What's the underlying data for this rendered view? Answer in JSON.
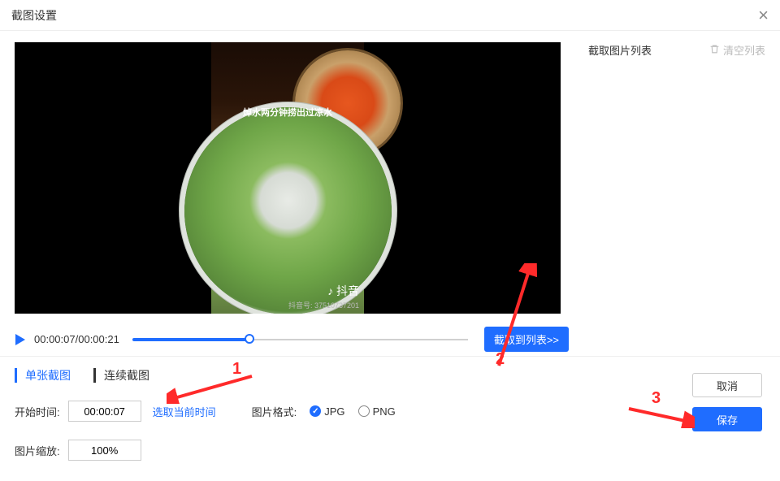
{
  "title": "截图设置",
  "play": {
    "current": "00:00:07",
    "total": "00:00:21"
  },
  "video_caption": "焯水两分钟捞出过凉水",
  "watermark_app": "抖音",
  "watermark_id": "抖音号: 37510737201",
  "capture_to_list": "截取到列表>>",
  "side": {
    "list_title": "截取图片列表",
    "clear": "清空列表"
  },
  "tabs": {
    "single": "单张截图",
    "continuous": "连续截图"
  },
  "form": {
    "start_label": "开始时间:",
    "start_value": "00:00:07",
    "pick_now": "选取当前时间",
    "format_label": "图片格式:",
    "format_jpg": "JPG",
    "format_png": "PNG",
    "zoom_label": "图片缩放:",
    "zoom_value": "100%"
  },
  "actions": {
    "cancel": "取消",
    "save": "保存"
  },
  "annotations": {
    "a1": "1",
    "a2": "2",
    "a3": "3"
  }
}
